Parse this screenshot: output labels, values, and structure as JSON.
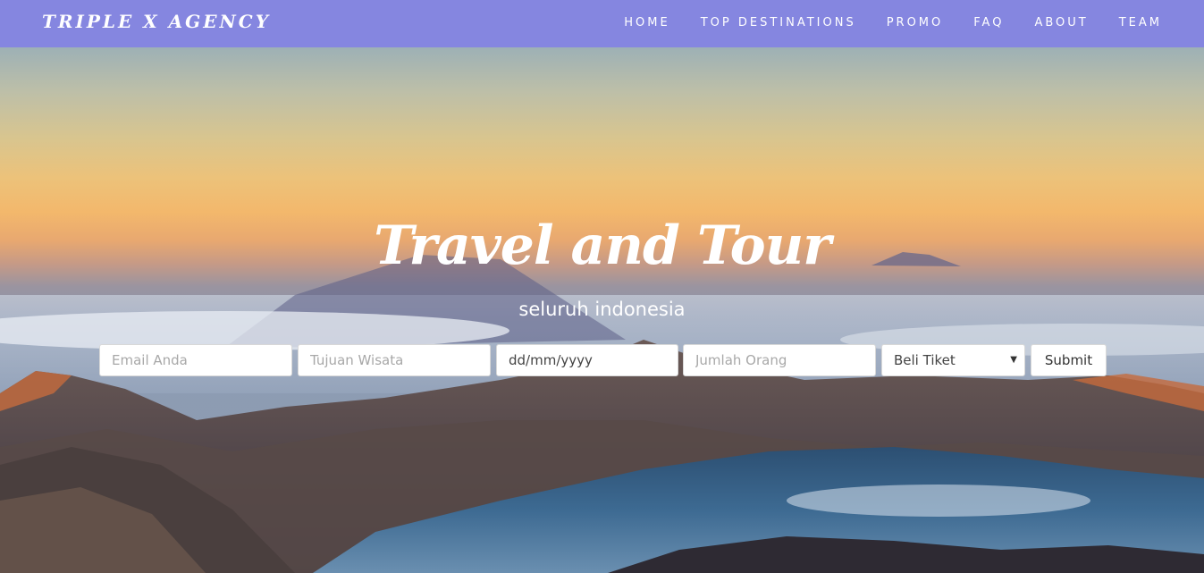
{
  "navbar": {
    "brand": "TRIPLE X AGENCY",
    "links": [
      {
        "label": "HOME"
      },
      {
        "label": "TOP DESTINATIONS"
      },
      {
        "label": "PROMO"
      },
      {
        "label": "FAQ"
      },
      {
        "label": "ABOUT"
      },
      {
        "label": "TEAM"
      }
    ],
    "bg_color": "#8586e0"
  },
  "hero": {
    "title": "Travel and Tour",
    "subtitle": "seluruh indonesia"
  },
  "form": {
    "email_placeholder": "Email Anda",
    "destination_placeholder": "Tujuan Wisata",
    "date_value": "dd/mm/yyyy",
    "people_placeholder": "Jumlah Orang",
    "ticket_select": "Beli Tiket",
    "submit_label": "Submit"
  }
}
